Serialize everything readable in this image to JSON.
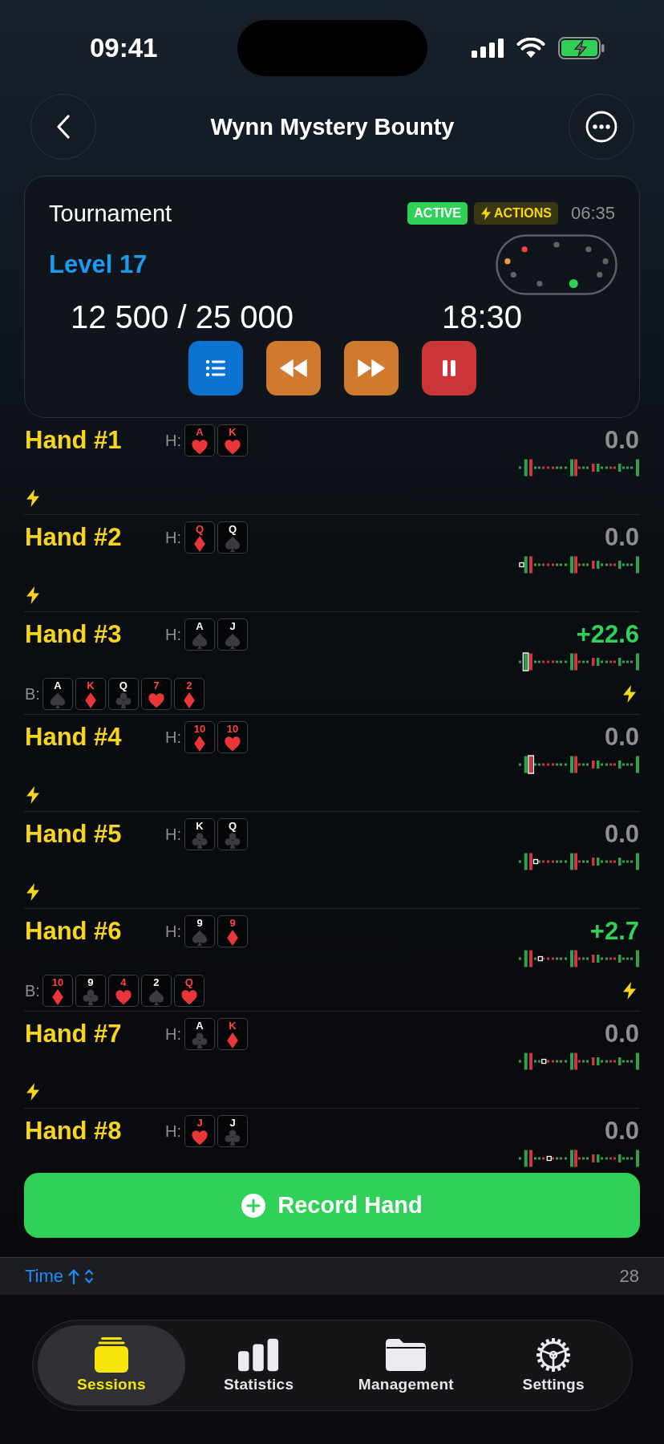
{
  "status_bar": {
    "time": "09:41"
  },
  "nav": {
    "title": "Wynn Mystery Bounty"
  },
  "tournament": {
    "title": "Tournament",
    "badges": [
      {
        "label": "ACTIVE",
        "kind": "status"
      },
      {
        "label": "ACTIONS",
        "kind": "actions"
      }
    ],
    "elapsed": "06:35",
    "level_label": "Level 17",
    "blinds": "12 500 / 25 000",
    "clock": "18:30",
    "seats": [
      {
        "color": "#636366",
        "selected": false
      },
      {
        "color": "#636366",
        "selected": false
      },
      {
        "color": "#636366",
        "selected": false
      },
      {
        "color": "#636366",
        "selected": false
      },
      {
        "color": "#30d158",
        "selected": true
      },
      {
        "color": "#636366",
        "selected": false
      },
      {
        "color": "#636366",
        "selected": false
      },
      {
        "color": "#f29b45",
        "selected": false
      },
      {
        "color": "#ff453a",
        "selected": false
      }
    ],
    "controls": [
      {
        "kind": "list"
      },
      {
        "kind": "rewind"
      },
      {
        "kind": "fast_forward"
      },
      {
        "kind": "pause"
      }
    ]
  },
  "hands": [
    {
      "title": "Hand #1",
      "hole_label": "H:",
      "hole_cards": [
        {
          "rank": "A",
          "kind": "hearts"
        },
        {
          "rank": "K",
          "kind": "hearts"
        }
      ],
      "result": "0.0",
      "color": "#8e8e93",
      "has_actions": true
    },
    {
      "title": "Hand #2",
      "hole_label": "H:",
      "hole_cards": [
        {
          "rank": "Q",
          "kind": "diamonds"
        },
        {
          "rank": "Q",
          "kind": "spades"
        }
      ],
      "result": "0.0",
      "color": "#8e8e93",
      "level": 0.01,
      "has_actions": true
    },
    {
      "title": "Hand #3",
      "hole_label": "H:",
      "hole_cards": [
        {
          "rank": "A",
          "kind": "spades"
        },
        {
          "rank": "J",
          "kind": "spades"
        }
      ],
      "result": "+22.6",
      "color": "#30d158",
      "level": 0.045,
      "board_label": "B:",
      "board": [
        {
          "rank": "A",
          "kind": "spades"
        },
        {
          "rank": "K",
          "kind": "diamonds"
        },
        {
          "rank": "Q",
          "kind": "clubs"
        },
        {
          "rank": "7",
          "kind": "hearts"
        },
        {
          "rank": "2",
          "kind": "diamonds"
        }
      ],
      "has_actions": true
    },
    {
      "title": "Hand #4",
      "hole_label": "H:",
      "hole_cards": [
        {
          "rank": "10",
          "kind": "diamonds"
        },
        {
          "rank": "10",
          "kind": "hearts"
        }
      ],
      "result": "0.0",
      "color": "#8e8e93",
      "level": 0.09,
      "has_actions": true
    },
    {
      "title": "Hand #5",
      "hole_label": "H:",
      "hole_cards": [
        {
          "rank": "K",
          "kind": "clubs"
        },
        {
          "rank": "Q",
          "kind": "clubs"
        }
      ],
      "result": "0.0",
      "color": "#8e8e93",
      "level": 0.13,
      "has_actions": true
    },
    {
      "title": "Hand #6",
      "hole_label": "H:",
      "hole_cards": [
        {
          "rank": "9",
          "kind": "spades"
        },
        {
          "rank": "9",
          "kind": "diamonds"
        }
      ],
      "result": "+2.7",
      "color": "#30d158",
      "level": 0.17,
      "board_label": "B:",
      "board": [
        {
          "rank": "10",
          "kind": "diamonds"
        },
        {
          "rank": "9",
          "kind": "clubs"
        },
        {
          "rank": "4",
          "kind": "hearts"
        },
        {
          "rank": "2",
          "kind": "spades"
        },
        {
          "rank": "Q",
          "kind": "hearts"
        }
      ],
      "has_actions": true
    },
    {
      "title": "Hand #7",
      "hole_label": "H:",
      "hole_cards": [
        {
          "rank": "A",
          "kind": "clubs"
        },
        {
          "rank": "K",
          "kind": "diamonds"
        }
      ],
      "result": "0.0",
      "color": "#8e8e93",
      "level": 0.2,
      "has_actions": true
    },
    {
      "title": "Hand #8",
      "hole_label": "H:",
      "hole_cards": [
        {
          "rank": "J",
          "kind": "hearts"
        },
        {
          "rank": "J",
          "kind": "clubs"
        }
      ],
      "result": "0.0",
      "color": "#8e8e93",
      "level": 0.245,
      "has_actions": false
    }
  ],
  "record_button": {
    "label": "Record Hand"
  },
  "sort_bar": {
    "label": "Time",
    "ascending": true,
    "count": "28"
  },
  "tab_bar": {
    "tabs": [
      {
        "label": "Sessions",
        "selected": true
      },
      {
        "label": "Statistics",
        "selected": false
      },
      {
        "label": "Management",
        "selected": false
      },
      {
        "label": "Settings",
        "selected": false
      }
    ]
  }
}
